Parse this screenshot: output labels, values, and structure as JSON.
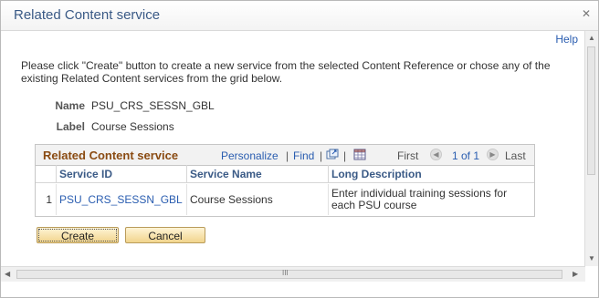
{
  "dialog": {
    "title": "Related Content service",
    "close_symbol": "✕",
    "help": "Help"
  },
  "instructions": "Please click \"Create\" button  to create a new service from the selected Content Reference or chose any of the existing  Related Content services from the grid below.",
  "fields": {
    "name_label": "Name",
    "name_value": "PSU_CRS_SESSN_GBL",
    "label_label": "Label",
    "label_value": "Course Sessions"
  },
  "grid": {
    "title": "Related Content service",
    "personalize": "Personalize",
    "find": "Find",
    "separator": "|",
    "view_all_icon": "new-window-icon",
    "download_icon": "spreadsheet-icon",
    "first": "First",
    "range": "1 of 1",
    "last": "Last",
    "columns": {
      "row_num": "",
      "service_id": "Service ID",
      "service_name": "Service Name",
      "long_description": "Long Description"
    },
    "rows": [
      {
        "row_num": "1",
        "service_id": "PSU_CRS_SESSN_GBL",
        "service_name": "Course Sessions",
        "long_description": "Enter individual training sessions for each PSU course"
      }
    ]
  },
  "buttons": {
    "create": "Create",
    "cancel": "Cancel"
  },
  "scrollbar": {
    "grip": "III"
  }
}
